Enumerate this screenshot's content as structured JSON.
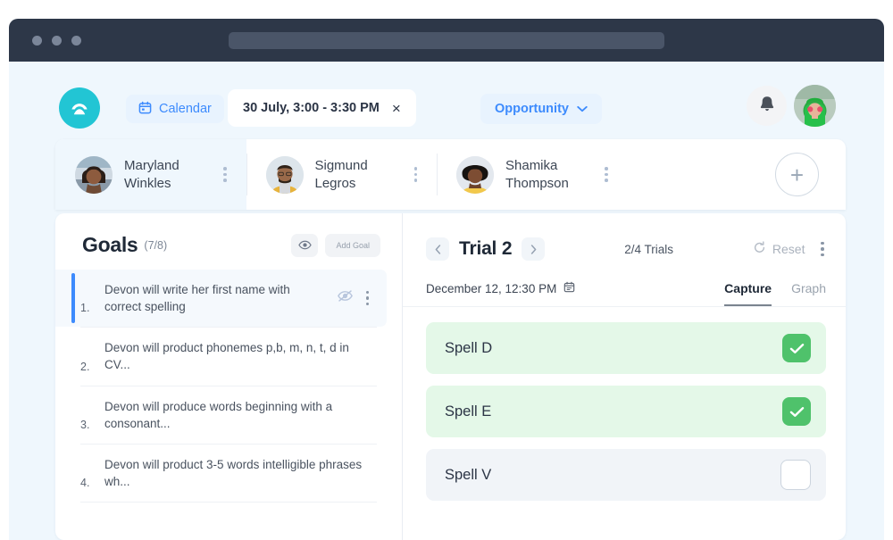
{
  "browser": {
    "traffic_lights": [
      "window-close",
      "window-minimize",
      "window-maximize"
    ],
    "url_value": ""
  },
  "topbar": {
    "logo_icon": "app-logo-icon",
    "logo_color": "#22c5d4",
    "calendar_label": "Calendar",
    "calendar_icon": "calendar-icon",
    "date_chip": "30 July, 3:00 - 3:30 PM",
    "date_chip_close": "×",
    "opportunity_label": "Opportunity",
    "opportunity_caret": "chevron-down-icon",
    "bell_icon": "bell-icon",
    "avatar_label": "user-avatar",
    "accent_blue": "#3d8bfd"
  },
  "clients": {
    "tabs": [
      {
        "name": "Maryland Winkles",
        "active": true
      },
      {
        "name": "Sigmund Legros",
        "active": false
      },
      {
        "name": "Shamika Thompson",
        "active": false
      }
    ],
    "add_label": "+"
  },
  "goals": {
    "title": "Goals",
    "count": "(7/8)",
    "eye_icon": "eye-icon",
    "add_goal_label": "Add Goal",
    "items": [
      {
        "num": "1.",
        "text": "Devon will write her first name with correct spelling",
        "selected": true,
        "eye_off_icon": "eye-off-icon"
      },
      {
        "num": "2.",
        "text": "Devon will product phonemes p,b, m, n, t, d in CV...",
        "selected": false
      },
      {
        "num": "3.",
        "text": "Devon will produce words beginning with a consonant...",
        "selected": false
      },
      {
        "num": "4.",
        "text": "Devon will product 3-5 words intelligible phrases wh...",
        "selected": false
      }
    ]
  },
  "trial": {
    "prev_icon": "chevron-left-icon",
    "next_icon": "chevron-right-icon",
    "title": "Trial 2",
    "counter": "2/4 Trials",
    "reset_label": "Reset",
    "reset_icon": "refresh-icon",
    "menu_icon": "kebab-menu-icon",
    "date": "December 12, 12:30 PM",
    "date_icon": "calendar-icon",
    "tabs": [
      {
        "label": "Capture",
        "active": true
      },
      {
        "label": "Graph",
        "active": false
      }
    ],
    "items": [
      {
        "label": "Spell D",
        "checked": true
      },
      {
        "label": "Spell E",
        "checked": true
      },
      {
        "label": "Spell V",
        "checked": false
      }
    ],
    "checked_color": "#4fc26b",
    "checked_bg": "#e4f8e8"
  }
}
